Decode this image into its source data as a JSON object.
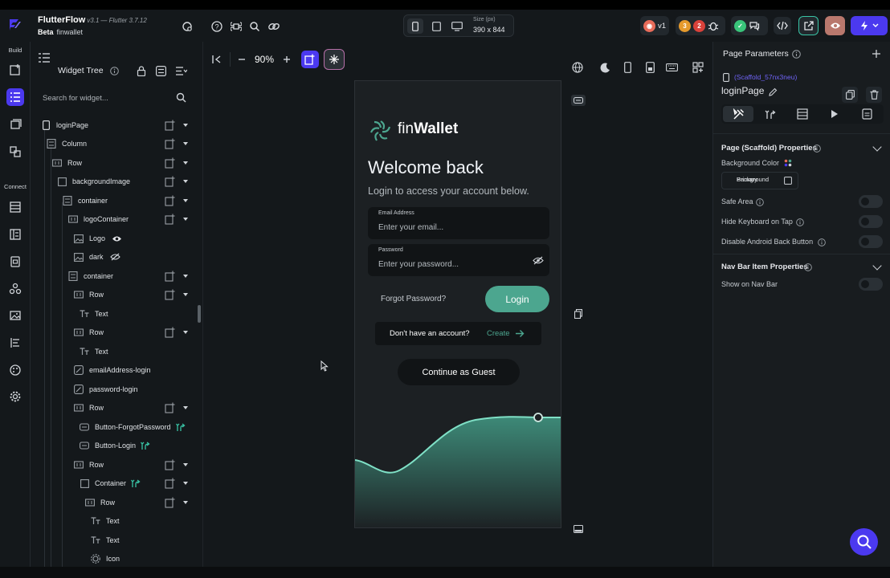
{
  "header": {
    "app_name": "FlutterFlow",
    "version": "v3.1",
    "sdk": "— Flutter 3.7.12",
    "channel": "Beta",
    "project": "finwallet",
    "size_label": "Size (px)",
    "size_value": "390 x 844",
    "version_badge": "v1",
    "warnings_count": "3",
    "errors_count": "2"
  },
  "rail": {
    "build_label": "Build",
    "connect_label": "Connect"
  },
  "widget_tree": {
    "title": "Widget Tree",
    "search_placeholder": "Search for widget...",
    "rows": [
      {
        "label": "loginPage"
      },
      {
        "label": "Column"
      },
      {
        "label": "Row"
      },
      {
        "label": "backgroundImage"
      },
      {
        "label": "container"
      },
      {
        "label": "logoContainer"
      },
      {
        "label": "Logo"
      },
      {
        "label": "dark"
      },
      {
        "label": "container"
      },
      {
        "label": "Row"
      },
      {
        "label": "Text"
      },
      {
        "label": "Row"
      },
      {
        "label": "Text"
      },
      {
        "label": "emailAddress-login"
      },
      {
        "label": "password-login"
      },
      {
        "label": "Row"
      },
      {
        "label": "Button-ForgotPassword"
      },
      {
        "label": "Button-Login"
      },
      {
        "label": "Row"
      },
      {
        "label": "Container"
      },
      {
        "label": "Row"
      },
      {
        "label": "Text"
      },
      {
        "label": "Text"
      },
      {
        "label": "Icon"
      }
    ]
  },
  "canvas": {
    "zoom": "90%",
    "screen": {
      "brand_prefix": "fin",
      "brand_suffix": "Wallet",
      "welcome": "Welcome back",
      "subtitle": "Login to access your account below.",
      "email_label": "Email Address",
      "email_placeholder": "Enter your email...",
      "password_label": "Password",
      "password_placeholder": "Enter your password...",
      "forgot": "Forgot Password?",
      "login": "Login",
      "no_account": "Don't have an account?",
      "create": "Create",
      "guest": "Continue as Guest"
    }
  },
  "properties": {
    "title": "Page Parameters",
    "scaffold_id": "(Scaffold_57nx3neu)",
    "page_name": "loginPage",
    "section_scaffold": "Page (Scaffold) Properties",
    "background_color_label": "Background Color",
    "background_color_value_line1": "Primary",
    "background_color_value_line2": "Background",
    "safe_area": "Safe Area",
    "hide_keyboard": "Hide Keyboard on Tap",
    "disable_back": "Disable Android Back Button",
    "section_navbar": "Nav Bar Item Properties",
    "show_nav_bar": "Show on Nav Bar"
  },
  "colors": {
    "accent": "#4b39ef",
    "primary_green": "#4ca68f",
    "background": "#14181b"
  }
}
